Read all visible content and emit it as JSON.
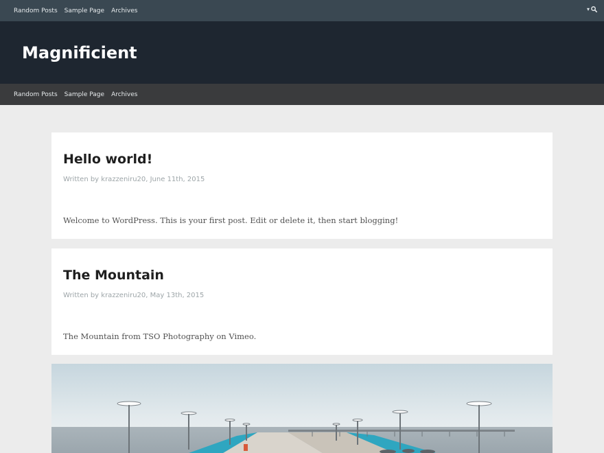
{
  "top_nav": {
    "items": [
      {
        "label": "Random Posts"
      },
      {
        "label": "Sample Page"
      },
      {
        "label": "Archives"
      }
    ],
    "search_icon": "search-icon",
    "dropdown_icon": "caret-down-icon"
  },
  "header": {
    "site_title": "Magnificient"
  },
  "main_nav": {
    "items": [
      {
        "label": "Random Posts"
      },
      {
        "label": "Sample Page"
      },
      {
        "label": "Archives"
      }
    ]
  },
  "posts": [
    {
      "title": "Hello world!",
      "meta": "Written by krazzeniru20, June 11th, 2015",
      "excerpt": "Welcome to WordPress. This is your first post. Edit or delete it, then start blogging!"
    },
    {
      "title": "The Mountain",
      "meta": "Written by krazzeniru20, May 13th, 2015",
      "excerpt": "The Mountain from TSO Photography on Vimeo."
    }
  ],
  "colors": {
    "topbar_bg": "#3a4852",
    "header_bg": "#1e2630",
    "subnav_bg": "#3a3b3d",
    "page_bg": "#ececec",
    "card_bg": "#ffffff",
    "meta_text": "#9da5a8"
  }
}
